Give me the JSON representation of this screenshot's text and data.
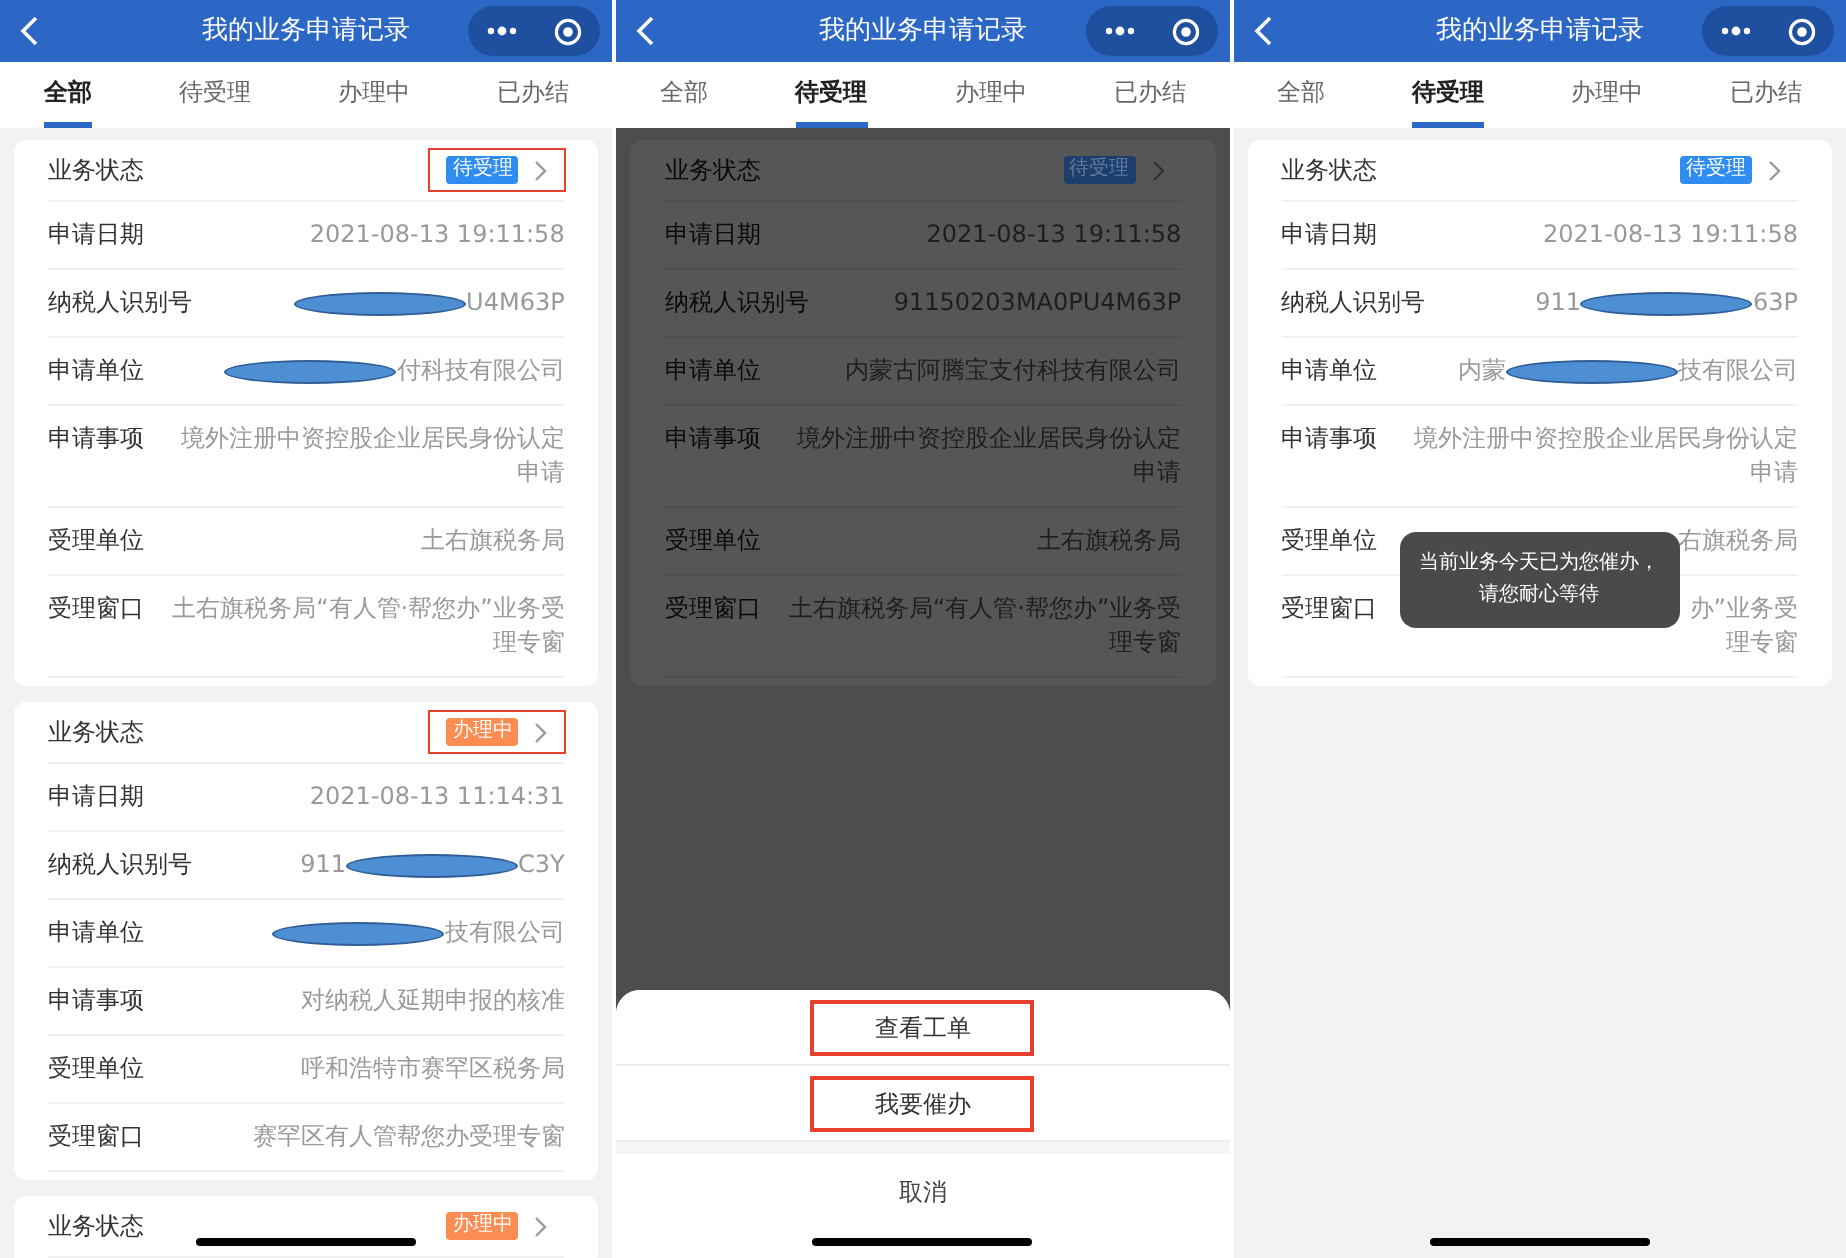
{
  "panels": [
    {
      "header": {
        "title": "我的业务申请记录"
      },
      "tabs": [
        {
          "label": "全部",
          "selected": true
        },
        {
          "label": "待受理",
          "selected": false
        },
        {
          "label": "办理中",
          "selected": false
        },
        {
          "label": "已办结",
          "selected": false
        }
      ],
      "cards": [
        {
          "fields": [
            {
              "kind": "status",
              "label": "业务状态",
              "badge": "待受理",
              "color": "#2f8cf0",
              "annotated": true
            },
            {
              "kind": "text",
              "label": "申请日期",
              "value": "2021-08-13 19:11:58"
            },
            {
              "kind": "redacted",
              "label": "纳税人识别号",
              "after": "U4M63P"
            },
            {
              "kind": "redacted",
              "label": "申请单位",
              "after": "付科技有限公司"
            },
            {
              "kind": "text",
              "label": "申请事项",
              "value": "境外注册中资控股企业居民身份认定申请"
            },
            {
              "kind": "text",
              "label": "受理单位",
              "value": "土右旗税务局"
            },
            {
              "kind": "text",
              "label": "受理窗口",
              "value": "土右旗税务局“有人管·帮您办”业务受理专窗"
            }
          ]
        },
        {
          "fields": [
            {
              "kind": "status",
              "label": "业务状态",
              "badge": "办理中",
              "color": "#fb8c52",
              "annotated": true
            },
            {
              "kind": "text",
              "label": "申请日期",
              "value": "2021-08-13 11:14:31"
            },
            {
              "kind": "redacted",
              "label": "纳税人识别号",
              "before": "911",
              "after": "C3Y"
            },
            {
              "kind": "redacted",
              "label": "申请单位",
              "after": "技有限公司"
            },
            {
              "kind": "text",
              "label": "申请事项",
              "value": "对纳税人延期申报的核准"
            },
            {
              "kind": "text",
              "label": "受理单位",
              "value": "呼和浩特市赛罕区税务局"
            },
            {
              "kind": "text",
              "label": "受理窗口",
              "value": "赛罕区有人管帮您办受理专窗"
            }
          ]
        },
        {
          "fields": [
            {
              "kind": "status",
              "label": "业务状态",
              "badge": "办理中",
              "color": "#fb8c52",
              "annotated": false
            }
          ]
        }
      ]
    },
    {
      "header": {
        "title": "我的业务申请记录"
      },
      "tabs": [
        {
          "label": "全部",
          "selected": false
        },
        {
          "label": "待受理",
          "selected": true
        },
        {
          "label": "办理中",
          "selected": false
        },
        {
          "label": "已办结",
          "selected": false
        }
      ],
      "cards": [
        {
          "fields": [
            {
              "kind": "status",
              "label": "业务状态",
              "badge": "待受理",
              "color": "#1d3e6c",
              "annotated": false
            },
            {
              "kind": "text",
              "label": "申请日期",
              "value": "2021-08-13 19:11:58"
            },
            {
              "kind": "text",
              "label": "纳税人识别号",
              "value": "91150203MA0PU4M63P"
            },
            {
              "kind": "text",
              "label": "申请单位",
              "value": "内蒙古阿腾宝支付科技有限公司"
            },
            {
              "kind": "text",
              "label": "申请事项",
              "value": "境外注册中资控股企业居民身份认定申请"
            },
            {
              "kind": "text",
              "label": "受理单位",
              "value": "土右旗税务局"
            },
            {
              "kind": "text",
              "label": "受理窗口",
              "value": "土右旗税务局“有人管·帮您办”业务受理专窗"
            }
          ]
        }
      ],
      "action_sheet": {
        "actions": [
          {
            "label": "查看工单",
            "annotated": true
          },
          {
            "label": "我要催办",
            "annotated": true
          }
        ],
        "cancel": "取消"
      }
    },
    {
      "header": {
        "title": "我的业务申请记录"
      },
      "tabs": [
        {
          "label": "全部",
          "selected": false
        },
        {
          "label": "待受理",
          "selected": true
        },
        {
          "label": "办理中",
          "selected": false
        },
        {
          "label": "已办结",
          "selected": false
        }
      ],
      "cards": [
        {
          "fields": [
            {
              "kind": "status",
              "label": "业务状态",
              "badge": "待受理",
              "color": "#2f8cf0",
              "annotated": false
            },
            {
              "kind": "text",
              "label": "申请日期",
              "value": "2021-08-13 19:11:58"
            },
            {
              "kind": "redacted",
              "label": "纳税人识别号",
              "before": "911",
              "after": "63P"
            },
            {
              "kind": "redacted",
              "label": "申请单位",
              "before": "内蒙",
              "after": "技有限公司"
            },
            {
              "kind": "text",
              "label": "申请事项",
              "value": "境外注册中资控股企业居民身份认定申请"
            },
            {
              "kind": "text",
              "label": "受理单位",
              "value": "右旗税务局"
            },
            {
              "kind": "lines",
              "label": "受理窗口",
              "lines": [
                "办”业务受",
                "理专窗"
              ]
            }
          ]
        }
      ],
      "toast": "当前业务今天已为您催办，请您耐心等待"
    }
  ]
}
